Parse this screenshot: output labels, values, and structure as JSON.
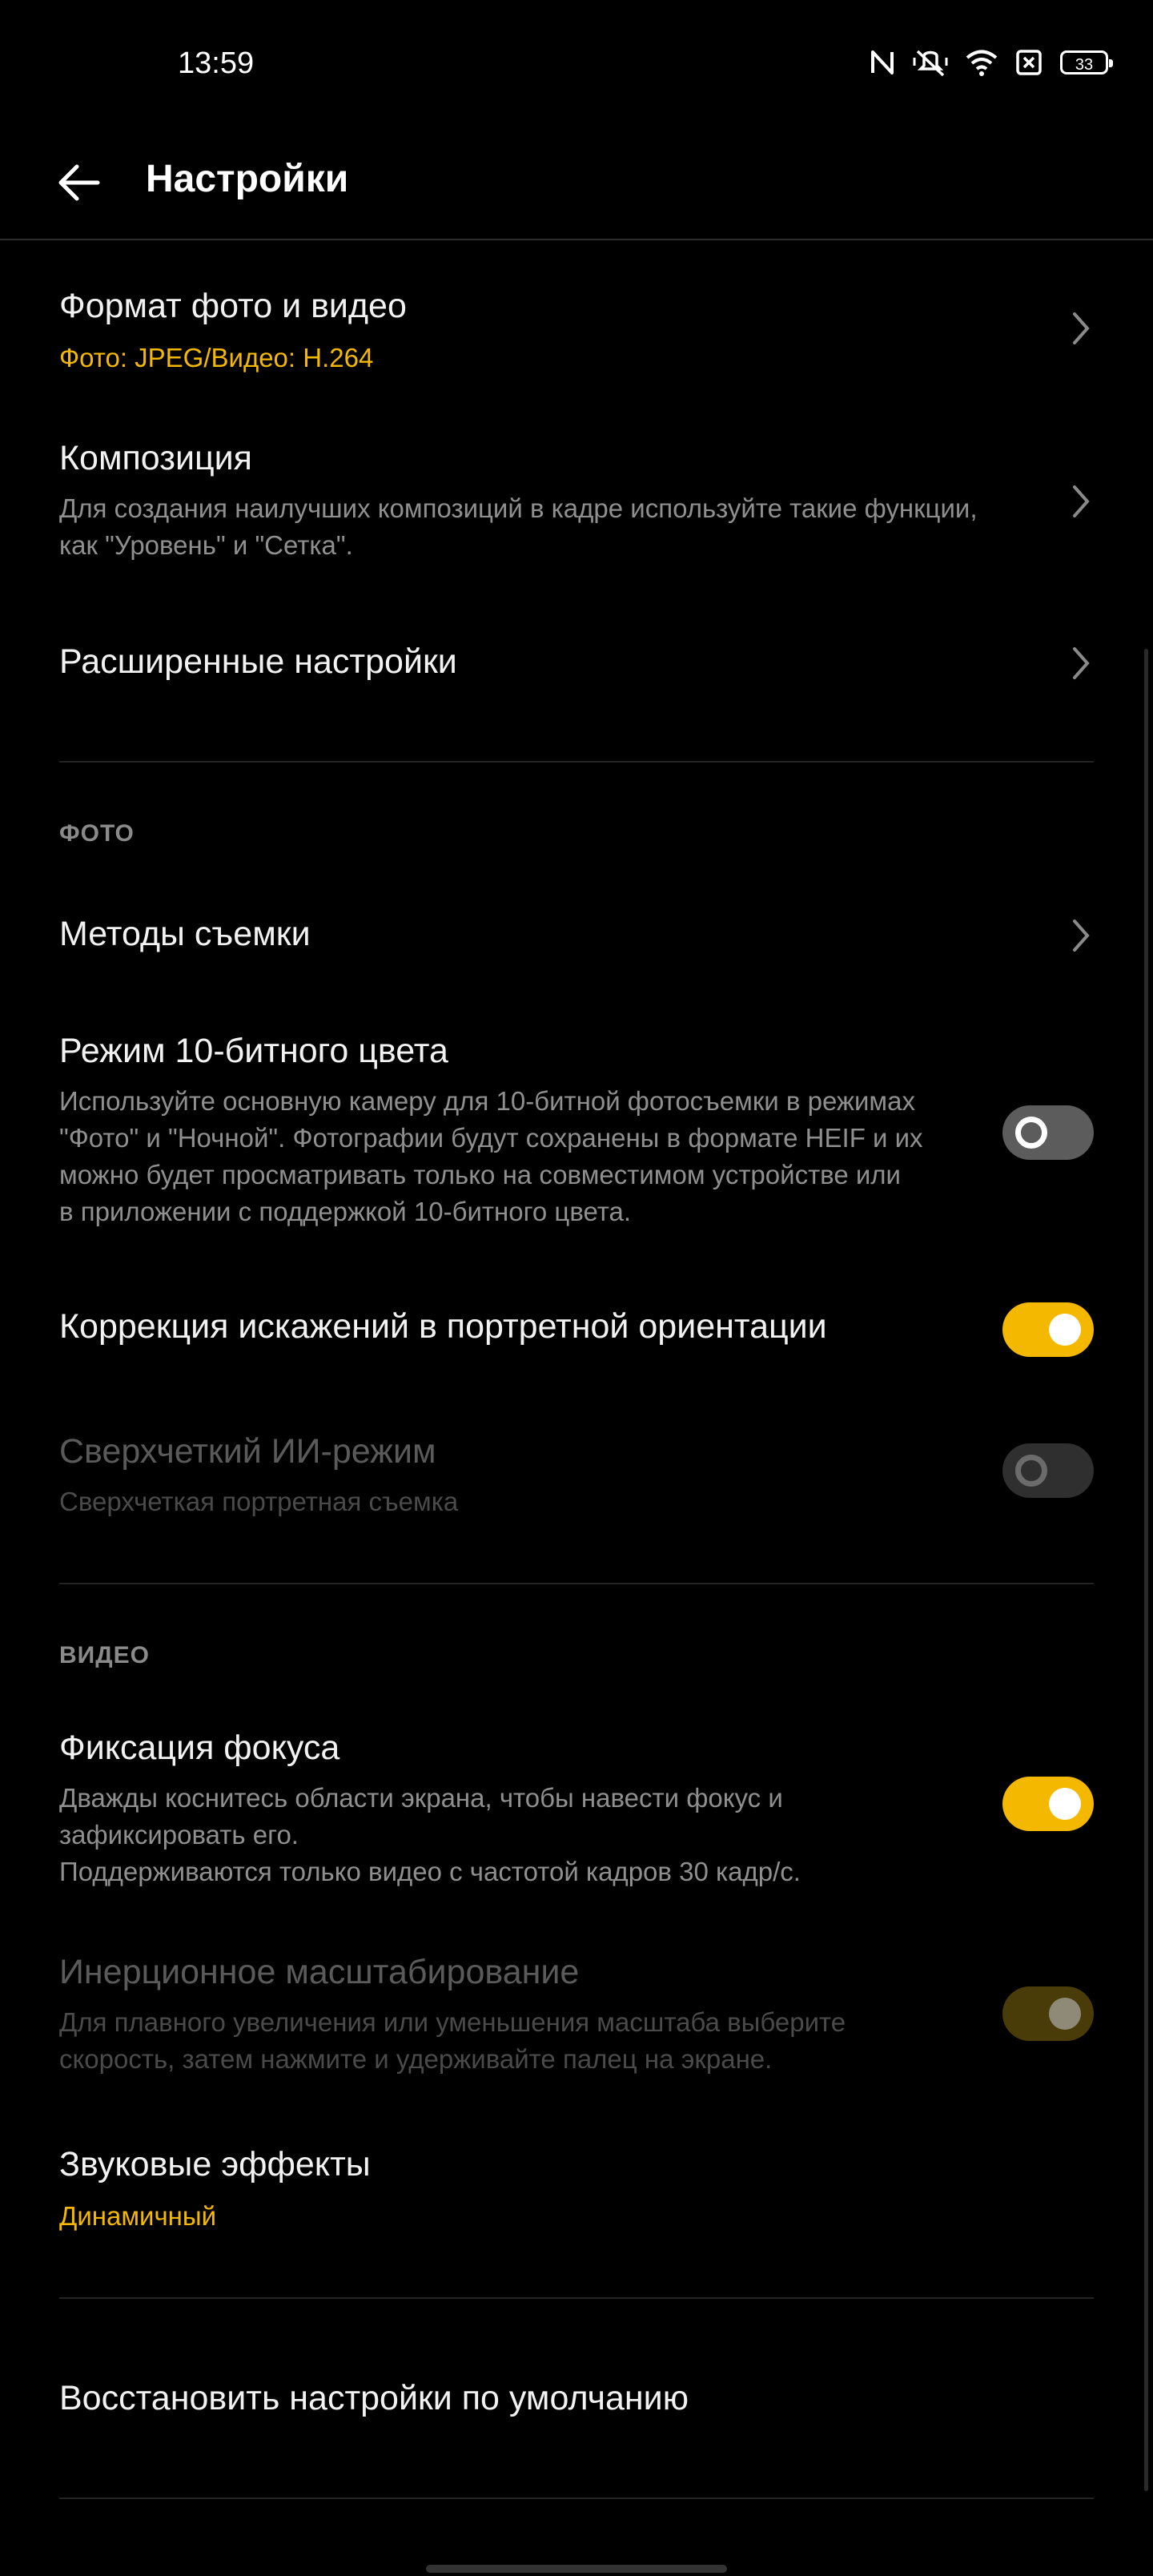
{
  "status": {
    "time": "13:59",
    "battery": "33"
  },
  "header": {
    "title": "Настройки"
  },
  "items": {
    "format": {
      "title": "Формат фото и видео",
      "value": "Фото: JPEG/Видео: H.264"
    },
    "composition": {
      "title": "Композиция",
      "desc_line1": "Для создания наилучших композиций в кадре используйте такие функции,",
      "desc_line2": "как \"Уровень\" и \"Сетка\"."
    },
    "advanced": {
      "title": "Расширенные настройки"
    },
    "section_photo": "ФОТО",
    "shooting_methods": {
      "title": "Методы съемки"
    },
    "ten_bit": {
      "title": "Режим 10-битного цвета",
      "desc_line1": "Используйте основную камеру для 10-битной фотосъемки в режимах",
      "desc_line2": "\"Фото\" и \"Ночной\". Фотографии будут сохранены в формате HEIF и их",
      "desc_line3": "можно будет просматривать только на совместимом устройстве или",
      "desc_line4": "в приложении с поддержкой 10-битного цвета.",
      "enabled": false
    },
    "distortion": {
      "title": "Коррекция искажений в портретной ориентации",
      "enabled": true
    },
    "ai_hd": {
      "title": "Сверхчеткий ИИ-режим",
      "desc": "Сверхчеткая портретная съемка",
      "enabled": false,
      "disabled": true
    },
    "section_video": "ВИДЕО",
    "focus_lock": {
      "title": "Фиксация фокуса",
      "desc_line1": "Дважды коснитесь области экрана, чтобы навести фокус и",
      "desc_line2": "зафиксировать его.",
      "desc_line3": "Поддерживаются только видео с частотой кадров 30 кадр/с.",
      "enabled": true
    },
    "inertial_zoom": {
      "title": "Инерционное масштабирование",
      "desc_line1": "Для плавного увеличения или уменьшения масштаба выберите",
      "desc_line2": "скорость, затем нажмите и удерживайте палец на экране.",
      "enabled": true,
      "disabled": true
    },
    "sound_effects": {
      "title": "Звуковые эффекты",
      "value": "Динамичный"
    },
    "reset": {
      "title": "Восстановить настройки по умолчанию"
    }
  },
  "colors": {
    "accent": "#f5b800",
    "background": "#000000",
    "text": "#f2f2f2",
    "secondary": "#8f8f8f"
  }
}
